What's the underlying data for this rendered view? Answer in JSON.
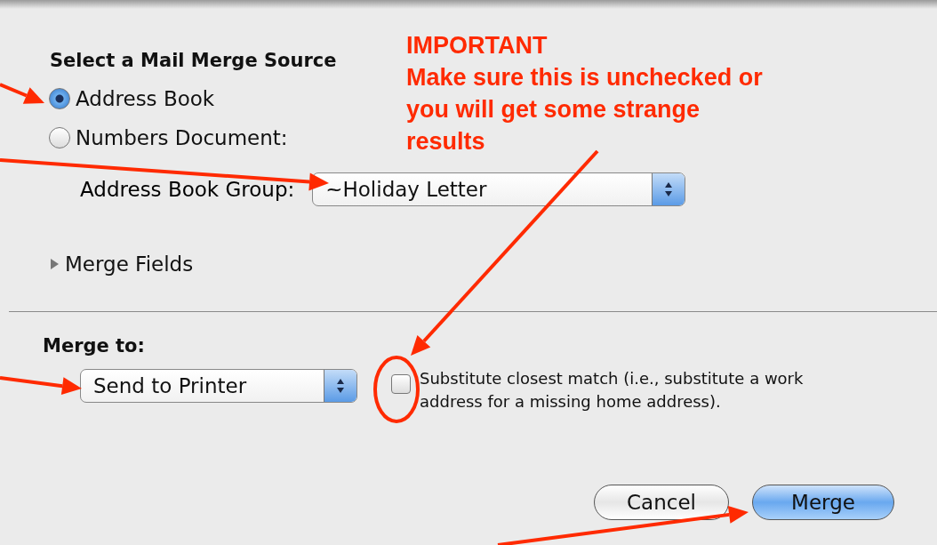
{
  "source": {
    "heading": "Select a Mail Merge Source",
    "options": [
      {
        "label": "Address Book",
        "selected": true
      },
      {
        "label": "Numbers Document:",
        "selected": false
      }
    ],
    "group_label": "Address Book Group:",
    "group_value": "~Holiday Letter"
  },
  "merge_fields": {
    "label": "Merge Fields",
    "expanded": false
  },
  "merge_to": {
    "label": "Merge to:",
    "value": "Send to Printer",
    "substitute": {
      "label": "Substitute closest match (i.e., substitute a work address for a missing home address).",
      "checked": false
    }
  },
  "buttons": [
    {
      "label": "Cancel",
      "default": false
    },
    {
      "label": "Merge",
      "default": true
    }
  ],
  "annotation": {
    "title": "IMPORTANT",
    "body": "Make sure this is unchecked or you will get some strange results"
  }
}
